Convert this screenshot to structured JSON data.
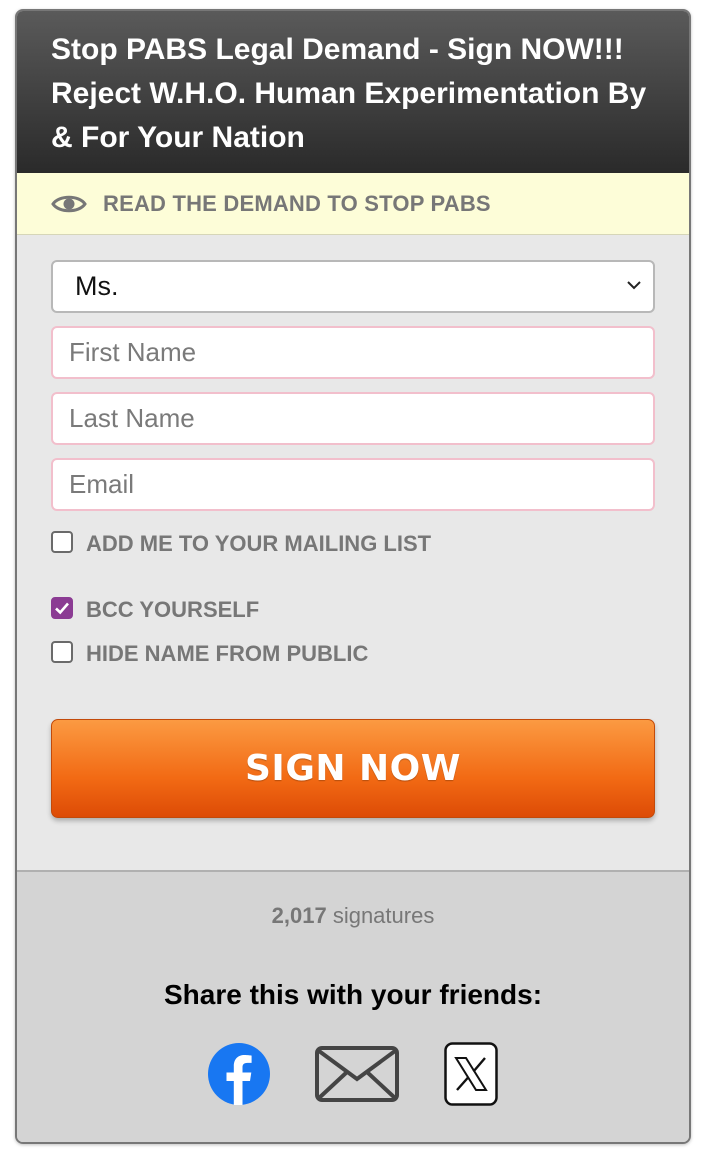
{
  "header": {
    "title": "Stop PABS Legal Demand - Sign NOW!!! Reject W.H.O. Human Experimentation By & For Your Nation"
  },
  "read_bar": {
    "label": "READ THE DEMAND TO STOP PABS",
    "icon": "eye-icon"
  },
  "form": {
    "salutation": {
      "selected": "Ms."
    },
    "first_name": {
      "placeholder": "First Name",
      "value": ""
    },
    "last_name": {
      "placeholder": "Last Name",
      "value": ""
    },
    "email": {
      "placeholder": "Email",
      "value": ""
    },
    "checkboxes": {
      "mailing_list": {
        "label": "ADD ME TO YOUR MAILING LIST",
        "checked": false
      },
      "bcc_yourself": {
        "label": "BCC YOURSELF",
        "checked": true
      },
      "hide_name": {
        "label": "HIDE NAME FROM PUBLIC",
        "checked": false
      }
    },
    "submit_label": "SIGN NOW"
  },
  "footer": {
    "signature_count": "2,017",
    "signature_suffix": "signatures",
    "share_title": "Share this with your friends:",
    "share_icons": [
      "facebook-icon",
      "email-icon",
      "x-icon"
    ]
  },
  "colors": {
    "header_bg": "#2a2a2a",
    "read_bar_bg": "#fdfdd8",
    "form_bg": "#e8e8e8",
    "input_border": "#f2bfcc",
    "checkbox_checked": "#8b3b93",
    "button_orange": "#f26a14",
    "facebook_blue": "#1877f2",
    "footer_bg": "#d4d4d4"
  }
}
